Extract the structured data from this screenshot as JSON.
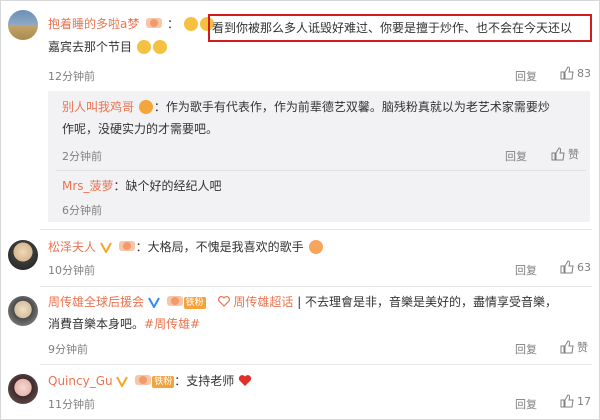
{
  "comments": [
    {
      "user": "抱着睡的多啦a梦",
      "text_part1": "：",
      "highlight_text": "看到你被那么多人诋毁好难过、你要是擅于炒作、也不会在今天还以",
      "text_line2": "嘉宾去那个节目",
      "time": "12分钟前",
      "reply_label": "回复",
      "likes": "83",
      "replies": [
        {
          "user": "别人叫我鸡哥",
          "text_line1": "：作为歌手有代表作，作为前辈德艺双馨。脑残粉真就以为老艺术家需要炒",
          "text_line2": "作呢，没硬实力的才需要吧。",
          "time": "2分钟前",
          "reply_label": "回复",
          "like_label": "赞"
        },
        {
          "user": "Mrs_菠萝",
          "text": "：缺个好的经纪人吧",
          "time": "6分钟前"
        }
      ]
    },
    {
      "user": "松泽夫人",
      "text": "：大格局，不愧是我喜欢的歌手",
      "time": "10分钟前",
      "reply_label": "回复",
      "likes": "63"
    },
    {
      "user": "周传雄全球后援会",
      "badge": "铁粉",
      "supertopic": "周传雄超话",
      "text_line1": "| 不去理會是非，音樂是美好的，盡情享受音樂，",
      "text_line2": "消費音樂本身吧。",
      "topic": "#周传雄#",
      "time": "9分钟前",
      "reply_label": "回复",
      "like_label": "赞"
    },
    {
      "user": "Quincy_Gu",
      "badge": "铁粉",
      "text": "：支持老师",
      "time": "11分钟前",
      "reply_label": "回复",
      "likes": "17"
    }
  ],
  "colors": {
    "username": "#eb7350",
    "highlight_border": "#d01e1e",
    "sub_bg": "#f2f2f5"
  }
}
